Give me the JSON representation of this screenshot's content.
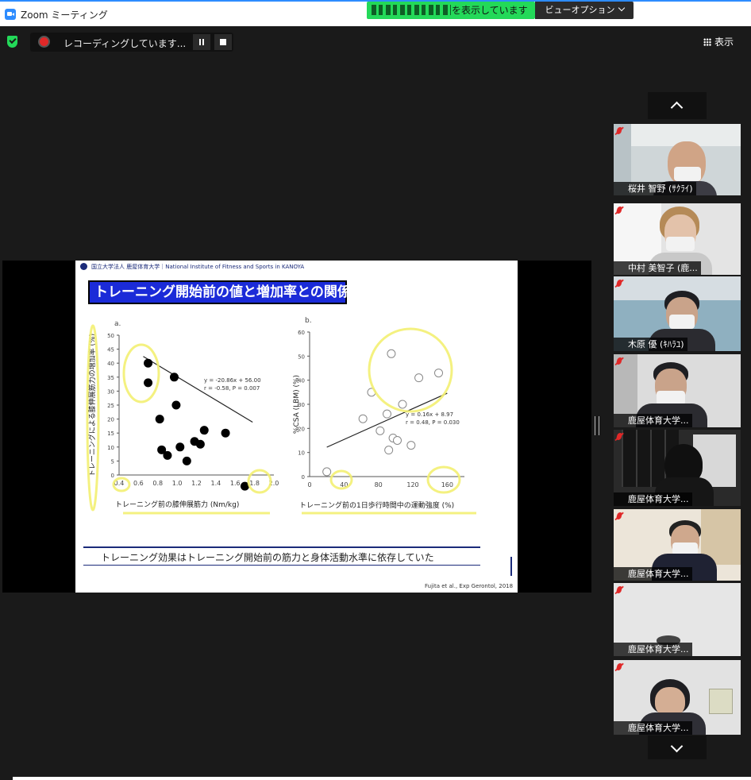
{
  "window": {
    "title": "Zoom ミーティング"
  },
  "share_banner": {
    "text": "を表示しています",
    "view_options_label": "ビューオプション"
  },
  "recording": {
    "status_text": "レコーディングしています..."
  },
  "view_button": {
    "label": "表示"
  },
  "slide": {
    "header": "国立大学法人 鹿屋体育大学｜National Institute of Fitness and Sports in KANOYA",
    "title": "トレーニング開始前の値と増加率との関係",
    "caption": "トレーニング効果はトレーニング開始前の筋力と身体活動水準に依存していた",
    "citation": "Fujita et al., Exp Gerontol, 2018"
  },
  "chart_data": [
    {
      "type": "scatter",
      "panel_label": "a",
      "xlabel": "トレーニング前の膝伸展筋力 (Nm/kg)",
      "ylabel": "トレーニングによる膝伸展筋力の増加率 (%)",
      "xlim": [
        0.4,
        2.0
      ],
      "ylim": [
        0,
        50
      ],
      "x_ticks": [
        0.4,
        0.6,
        0.8,
        1.0,
        1.2,
        1.4,
        1.6,
        1.8,
        2.0
      ],
      "y_ticks": [
        0,
        5,
        10,
        15,
        20,
        25,
        30,
        35,
        40,
        45,
        50
      ],
      "x_tick_labels": [
        "0.4",
        "0.6",
        "0.8",
        "1.0",
        "1.2",
        "1.4",
        "1.6",
        "1.8",
        "2.0"
      ],
      "y_tick_labels": [
        "0",
        "5",
        "10",
        "15",
        "20",
        "25",
        "30",
        "35",
        "40",
        "45",
        "50"
      ],
      "annotation": [
        "y = -20.86x + 56.00",
        "r = -0.58, P = 0.007"
      ],
      "marker": "filled",
      "points": [
        {
          "x": 0.7,
          "y": 40
        },
        {
          "x": 0.7,
          "y": 33
        },
        {
          "x": 0.97,
          "y": 35
        },
        {
          "x": 0.99,
          "y": 25
        },
        {
          "x": 0.82,
          "y": 20
        },
        {
          "x": 1.28,
          "y": 16
        },
        {
          "x": 1.5,
          "y": 15
        },
        {
          "x": 1.18,
          "y": 12
        },
        {
          "x": 1.24,
          "y": 11
        },
        {
          "x": 0.84,
          "y": 9
        },
        {
          "x": 0.9,
          "y": 7
        },
        {
          "x": 1.03,
          "y": 10
        },
        {
          "x": 1.1,
          "y": 5
        },
        {
          "x": 1.7,
          "y": -4
        }
      ],
      "trend": [
        {
          "x": 0.65,
          "y": 42.4
        },
        {
          "x": 1.78,
          "y": 18.9
        }
      ]
    },
    {
      "type": "scatter",
      "panel_label": "b",
      "xlabel": "トレーニング前の1日歩行時間中の運動強度 (%)",
      "ylabel": "%CSA (LBM) (%)",
      "xlim": [
        0,
        180
      ],
      "ylim": [
        0,
        60
      ],
      "x_ticks": [
        0,
        40,
        80,
        120,
        160
      ],
      "y_ticks": [
        0,
        10,
        20,
        30,
        40,
        50,
        60
      ],
      "x_tick_labels": [
        "0",
        "40",
        "80",
        "120",
        "160"
      ],
      "y_tick_labels": [
        "0",
        "10",
        "20",
        "30",
        "40",
        "50",
        "60"
      ],
      "annotation": [
        "y = 0.16x + 8.97",
        "r = 0.48, P = 0.030"
      ],
      "marker": "open",
      "points": [
        {
          "x": 95,
          "y": 51
        },
        {
          "x": 150,
          "y": 43
        },
        {
          "x": 127,
          "y": 41
        },
        {
          "x": 72,
          "y": 35
        },
        {
          "x": 108,
          "y": 30
        },
        {
          "x": 90,
          "y": 26
        },
        {
          "x": 62,
          "y": 24
        },
        {
          "x": 82,
          "y": 19
        },
        {
          "x": 97,
          "y": 16
        },
        {
          "x": 102,
          "y": 15
        },
        {
          "x": 92,
          "y": 11
        },
        {
          "x": 118,
          "y": 13
        },
        {
          "x": 20,
          "y": 2
        }
      ],
      "trend": [
        {
          "x": 20,
          "y": 12.2
        },
        {
          "x": 160,
          "y": 34.6
        }
      ]
    }
  ],
  "participants": [
    {
      "name": "桜井 智野 (ｻｸﾗｲ)"
    },
    {
      "name": "中村 美智子 (鹿..."
    },
    {
      "name": "木原 優 (ｷﾊﾗﾕ)"
    },
    {
      "name": "鹿屋体育大学..."
    },
    {
      "name": "鹿屋体育大学..."
    },
    {
      "name": "鹿屋体育大学..."
    },
    {
      "name": "鹿屋体育大学..."
    },
    {
      "name": "鹿屋体育大学..."
    }
  ],
  "colors": {
    "accent": "#2d8cff",
    "share_green": "#23d959",
    "slide_title_bg": "#1b2bd8",
    "highlight": "#f3ef72"
  }
}
